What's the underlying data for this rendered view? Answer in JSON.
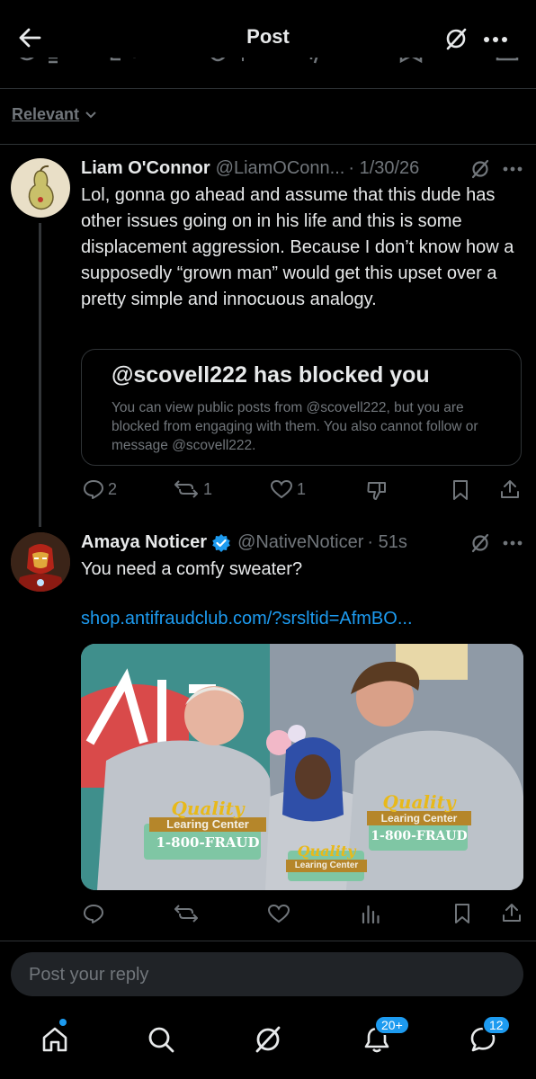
{
  "header": {
    "title": "Post"
  },
  "sort": {
    "label": "Relevant"
  },
  "colors": {
    "accent": "#1d9bf0",
    "link": "#1d9bf0",
    "text": "#e7e9ea",
    "muted": "#71767b",
    "border": "#2f3336"
  },
  "reply1": {
    "name": "Liam O'Connor",
    "handle": "@LiamOConn...",
    "date": "· 1/30/26",
    "text": "Lol, gonna go ahead and assume that this dude has other issues going on in his life and this is some displacement aggression.  Because I don’t know how a supposedly “grown man” would get this upset over a pretty simple and innocuous analogy.",
    "blocked_title": "@scovell222 has blocked you",
    "blocked_body": "You can view public posts from @scovell222, but you are blocked from engaging with them. You also cannot follow or message @scovell222.",
    "replies": "2",
    "reposts": "1",
    "likes": "1"
  },
  "reply2": {
    "name": "Amaya Noticer",
    "handle": "@NativeNoticer",
    "date": "· 51s",
    "text": "You need a comfy sweater?",
    "link": "shop.antifraudclub.com/?srsltid=AfmBO...",
    "image": {
      "sweater_line1": "Quality",
      "sweater_line2": "Learing Center",
      "sweater_line3": "1-800-FRAUD"
    }
  },
  "reply_box": {
    "placeholder": "Post your reply"
  },
  "bottom_nav": {
    "notifications_badge": "20+",
    "messages_badge": "12"
  }
}
